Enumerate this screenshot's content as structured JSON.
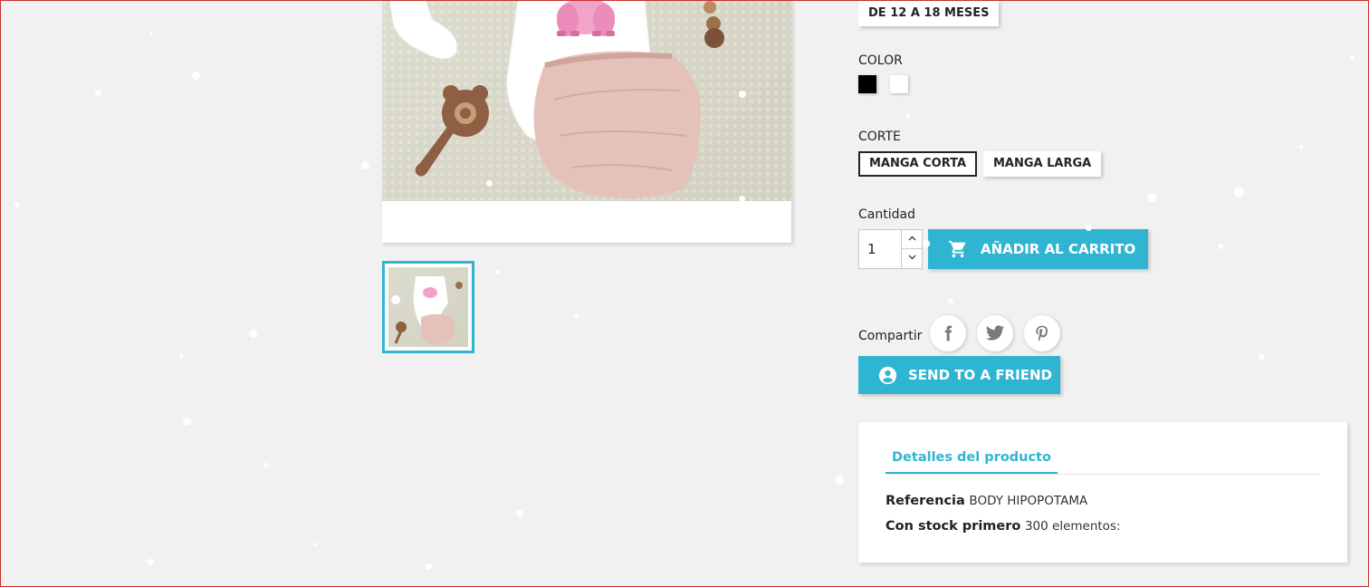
{
  "size_selected": "DE 12 A 18 MESES",
  "color": {
    "label": "COLOR",
    "swatches": [
      {
        "name": "black",
        "hex": "#000000"
      },
      {
        "name": "white",
        "hex": "#ffffff"
      }
    ]
  },
  "corte": {
    "label": "CORTE",
    "options": [
      "MANGA CORTA",
      "MANGA LARGA"
    ],
    "selected": "MANGA CORTA"
  },
  "cantidad": {
    "label": "Cantidad",
    "value": "1"
  },
  "add_to_cart": "AÑADIR AL CARRITO",
  "share": {
    "label": "Compartir",
    "networks": [
      "facebook",
      "twitter",
      "pinterest"
    ]
  },
  "send_friend": "SEND TO A FRIEND",
  "details": {
    "tab": "Detalles del producto",
    "reference_label": "Referencia",
    "reference_value": "BODY HIPOPOTAMA",
    "stock_label": "Con stock primero",
    "stock_value": "300 elementos:"
  },
  "colors": {
    "accent": "#2fb5d2",
    "text": "#232323",
    "background": "#f1f1f1"
  }
}
